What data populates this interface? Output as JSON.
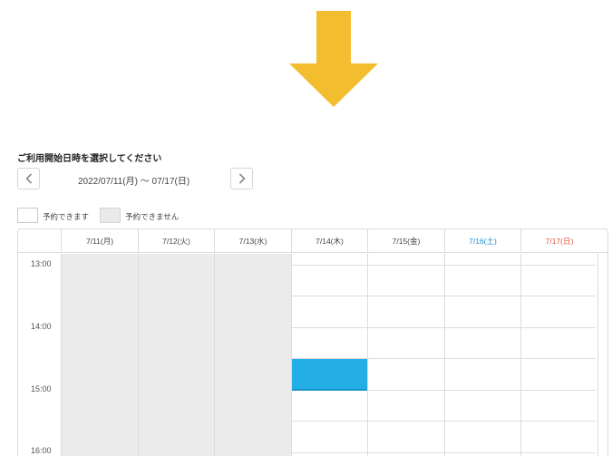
{
  "colors": {
    "arrow": "#f2bd2f",
    "selected": "#23aee6",
    "unavailable": "#ebebeb",
    "saturday": "#1e90d8",
    "sunday": "#e2563b"
  },
  "page": {
    "title": "ご利用開始日時を選択してください",
    "date_range": "2022/07/11(月) ～ 07/17(日)",
    "prev_icon": "chevron-left-icon",
    "next_icon": "chevron-right-icon"
  },
  "legend": {
    "available": "予約できます",
    "unavailable": "予約できません"
  },
  "calendar": {
    "days": [
      {
        "label": "7/11(月)",
        "available": false
      },
      {
        "label": "7/12(火)",
        "available": false
      },
      {
        "label": "7/13(水)",
        "available": false
      },
      {
        "label": "7/14(木)",
        "available": true
      },
      {
        "label": "7/15(金)",
        "available": true
      },
      {
        "label": "7/16(土)",
        "available": true
      },
      {
        "label": "7/17(日)",
        "available": true
      }
    ],
    "times": [
      "13:00",
      "14:00",
      "15:00",
      "16:00"
    ],
    "selected": {
      "day": "7/14(木)",
      "start": "15:00"
    }
  }
}
